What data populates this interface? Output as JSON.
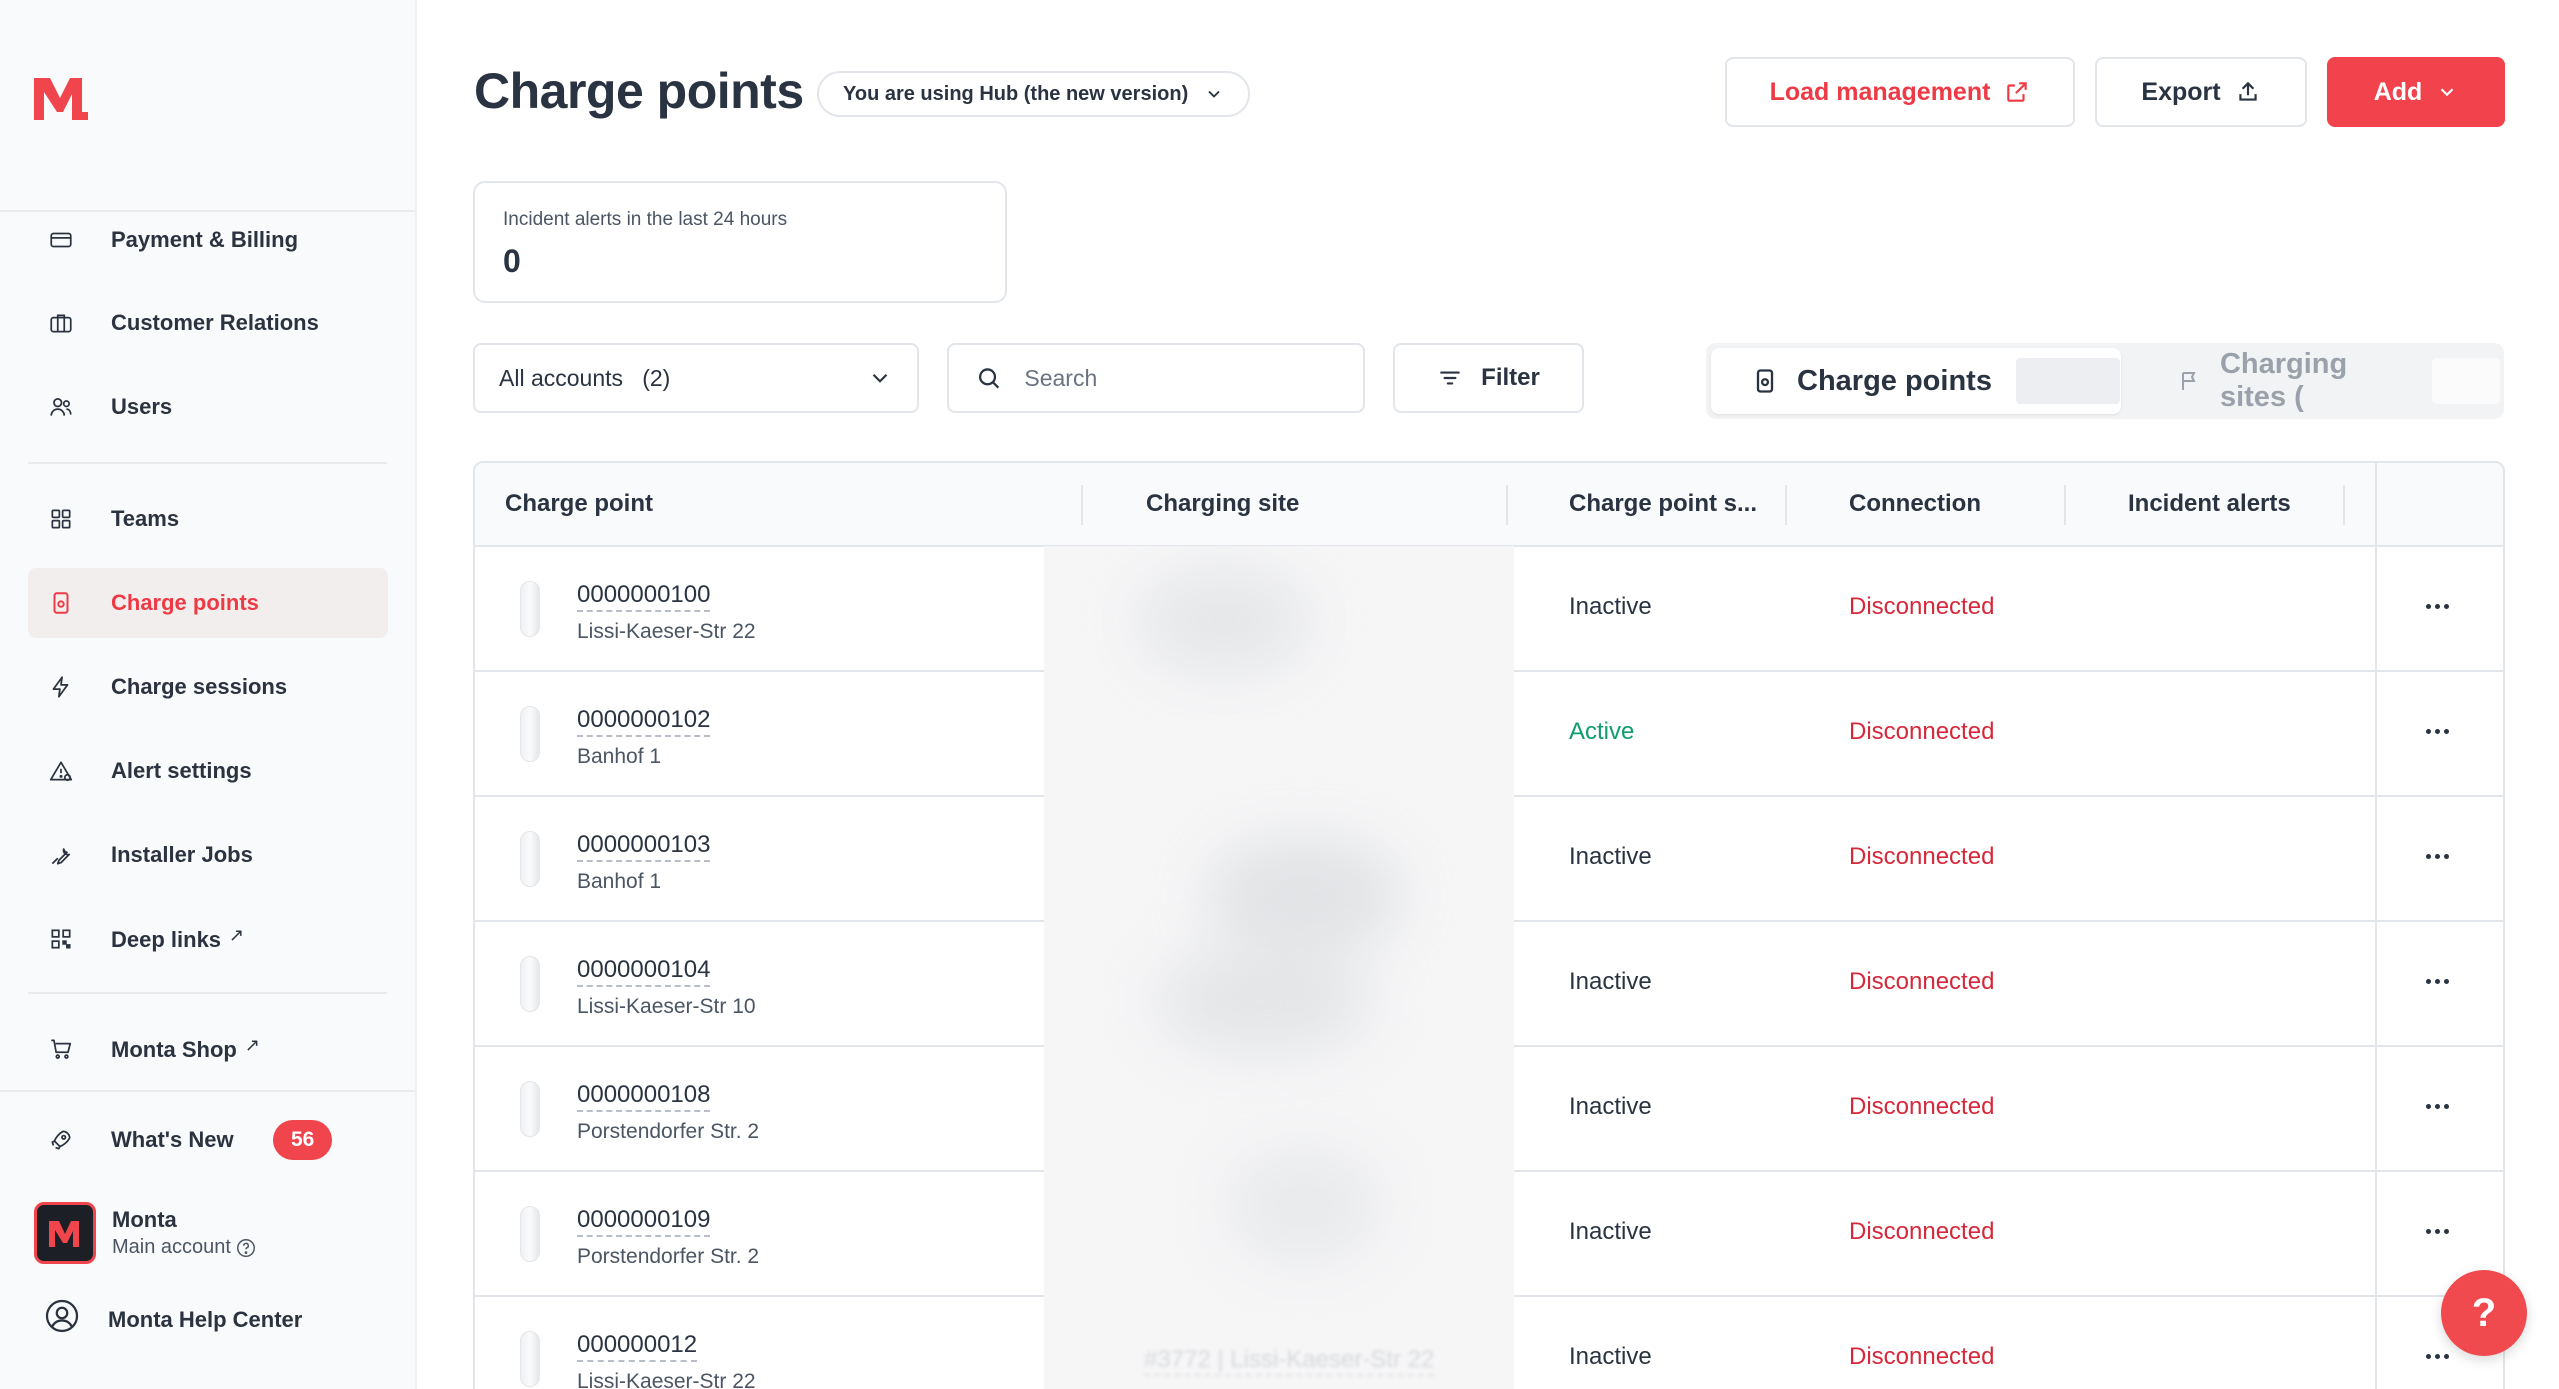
{
  "sidebar": {
    "logo_text": "M.",
    "items": [
      {
        "label": "Payment & Billing",
        "icon": "credit-card-icon"
      },
      {
        "label": "Customer Relations",
        "icon": "briefcase-icon"
      },
      {
        "label": "Users",
        "icon": "users-icon"
      },
      {
        "label": "Teams",
        "icon": "grid-icon"
      },
      {
        "label": "Charge points",
        "icon": "charger-icon",
        "active": true
      },
      {
        "label": "Charge sessions",
        "icon": "lightning-icon"
      },
      {
        "label": "Alert settings",
        "icon": "alert-triangle-icon"
      },
      {
        "label": "Installer Jobs",
        "icon": "wrench-icon"
      },
      {
        "label": "Deep links",
        "icon": "qr-code-icon",
        "external": true
      },
      {
        "label": "Monta Shop",
        "icon": "cart-icon",
        "external": true
      },
      {
        "label": "What's New",
        "icon": "rocket-icon",
        "badge": "56"
      }
    ],
    "account": {
      "name": "Monta",
      "sub": "Main account",
      "avatar_letter": "M"
    },
    "help_center": "Monta Help Center"
  },
  "header": {
    "title": "Charge points",
    "hub_notice": "You are using Hub (the new version)",
    "load_management": "Load management",
    "export": "Export",
    "add": "Add"
  },
  "incident_card": {
    "label": "Incident alerts in the last 24 hours",
    "value": "0"
  },
  "controls": {
    "accounts_select": "All accounts",
    "accounts_count": "(2)",
    "search_placeholder": "Search",
    "filter": "Filter",
    "view_toggle": {
      "charge_points": "Charge points",
      "charging_sites": "Charging sites ("
    }
  },
  "table": {
    "columns": [
      "Charge point",
      "Charging site",
      "Charge point s...",
      "Connection",
      "Incident alerts"
    ],
    "rows": [
      {
        "id": "0000000100",
        "address": "Lissi-Kaeser-Str 22",
        "status": "Inactive",
        "connection": "Disconnected"
      },
      {
        "id": "0000000102",
        "address": "Banhof 1",
        "status": "Active",
        "connection": "Disconnected"
      },
      {
        "id": "0000000103",
        "address": "Banhof 1",
        "status": "Inactive",
        "connection": "Disconnected"
      },
      {
        "id": "0000000104",
        "address": "Lissi-Kaeser-Str 10",
        "status": "Inactive",
        "connection": "Disconnected"
      },
      {
        "id": "0000000108",
        "address": "Porstendorfer Str. 2",
        "status": "Inactive",
        "connection": "Disconnected"
      },
      {
        "id": "0000000109",
        "address": "Porstendorfer Str. 2",
        "status": "Inactive",
        "connection": "Disconnected"
      },
      {
        "id": "000000012",
        "address": "Lissi-Kaeser-Str 22",
        "status": "Inactive",
        "connection": "Disconnected"
      }
    ],
    "last_row_site_partial": "#3772 | Lissi-Kaeser-Str 22"
  },
  "help_fab": "?",
  "colors": {
    "brand": "#f2424c",
    "active_nav_text": "#ee3a45",
    "status_active": "#109d6e",
    "disconnected": "#d6283a"
  }
}
